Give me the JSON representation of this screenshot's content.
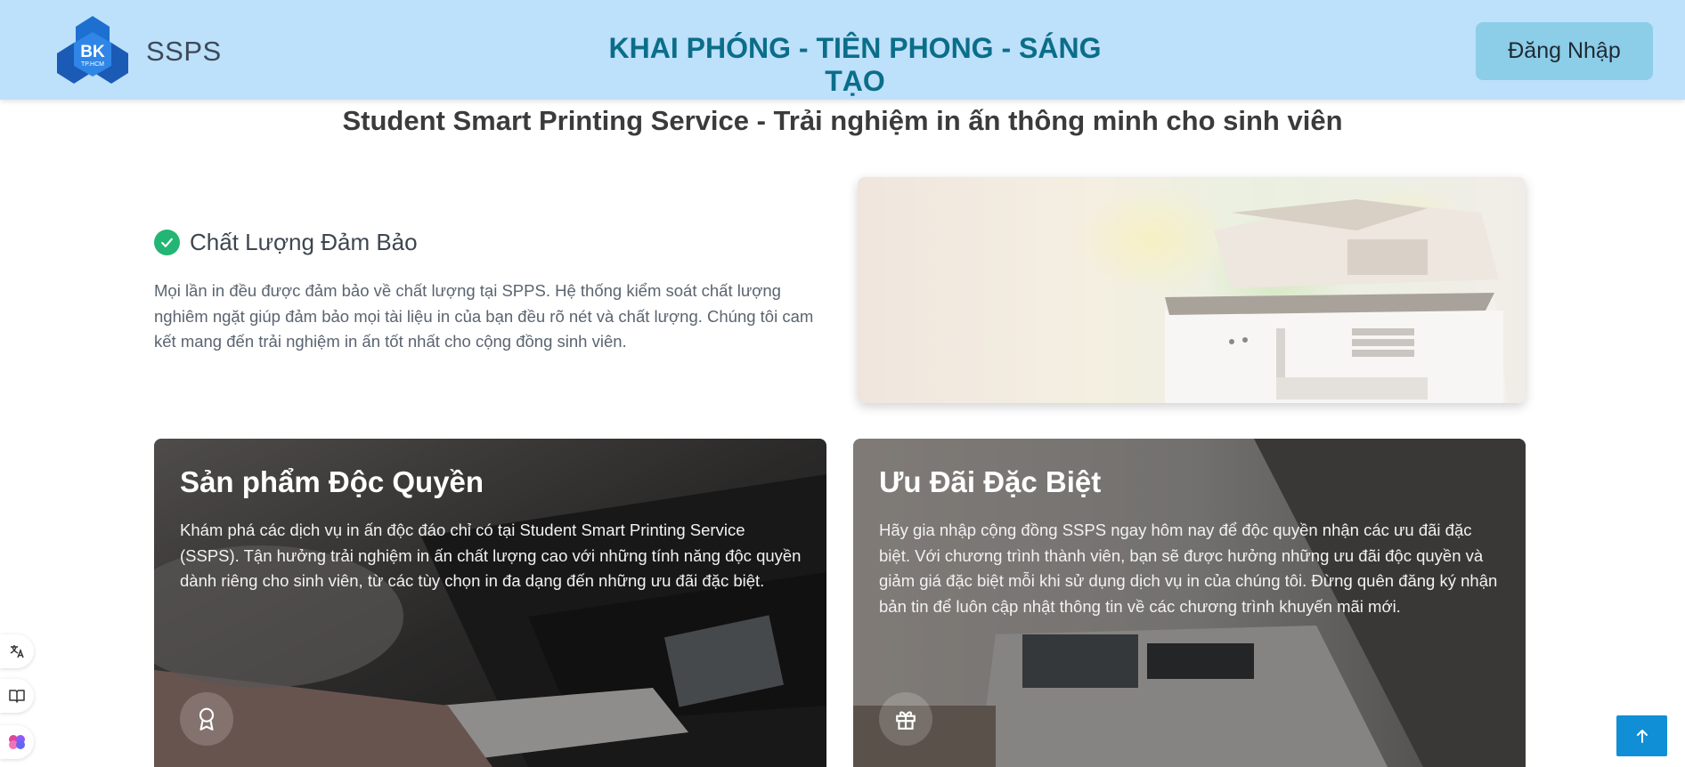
{
  "header": {
    "logo_text": "BK",
    "logo_subtext": "TP.HCM",
    "brand": "SSPS",
    "slogan": "KHAI PHÓNG - TIÊN PHONG - SÁNG TẠO",
    "login_label": "Đăng Nhập"
  },
  "page_title": "Student Smart Printing Service - Trải nghiệm in ấn thông minh cho sinh viên",
  "quality": {
    "icon": "check-circle-icon",
    "title": "Chất Lượng Đảm Bảo",
    "text": "Mọi lần in đều được đảm bảo về chất lượng tại SPPS. Hệ thống kiểm soát chất lượng nghiêm ngặt giúp đảm bảo mọi tài liệu in của bạn đều rõ nét và chất lượng. Chúng tôi cam kết mang đến trải nghiệm in ấn tốt nhất cho cộng đồng sinh viên."
  },
  "cards": [
    {
      "title": "Sản phẩm Độc Quyền",
      "text": "Khám phá các dịch vụ in ấn độc đáo chỉ có tại Student Smart Printing Service (SSPS). Tận hưởng trải nghiệm in ấn chất lượng cao với những tính năng độc quyền dành riêng cho sinh viên, từ các tùy chọn in đa dạng đến những ưu đãi đặc biệt.",
      "icon": "award-icon"
    },
    {
      "title": "Ưu Đãi Đặc Biệt",
      "text": "Hãy gia nhập cộng đồng SSPS ngay hôm nay để độc quyền nhận các ưu đãi đặc biệt. Với chương trình thành viên, bạn sẽ được hưởng những ưu đãi độc quyền và giảm giá đặc biệt mỗi khi sử dụng dịch vụ in của chúng tôi. Đừng quên đăng ký nhận bản tin để luôn cập nhật thông tin về các chương trình khuyến mãi mới.",
      "icon": "gift-icon"
    }
  ],
  "side_tools": [
    "translate-icon",
    "book-icon",
    "brain-icon"
  ],
  "colors": {
    "header_bg": "#bde0fb",
    "slogan": "#0b6e89",
    "login_bg": "#8ccde8",
    "check": "#22b573",
    "to_top": "#108fd6"
  }
}
